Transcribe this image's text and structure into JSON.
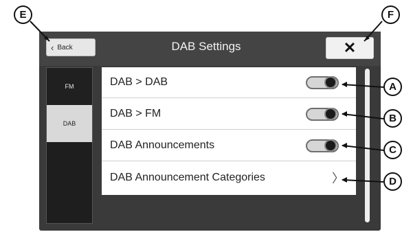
{
  "header": {
    "back_label": "Back",
    "title": "DAB Settings",
    "close_label": "✕"
  },
  "sidebar": {
    "tabs": [
      {
        "label": "FM",
        "selected": false
      },
      {
        "label": "DAB",
        "selected": true
      }
    ]
  },
  "settings": [
    {
      "label": "DAB > DAB",
      "control": "toggle",
      "on": true
    },
    {
      "label": "DAB > FM",
      "control": "toggle",
      "on": true
    },
    {
      "label": "DAB Announcements",
      "control": "toggle",
      "on": true
    },
    {
      "label": "DAB Announcement Categories",
      "control": "chevron",
      "chevron": "〉"
    }
  ],
  "callouts": {
    "e": "E",
    "f": "F",
    "a": "A",
    "b": "B",
    "c": "C",
    "d": "D"
  }
}
